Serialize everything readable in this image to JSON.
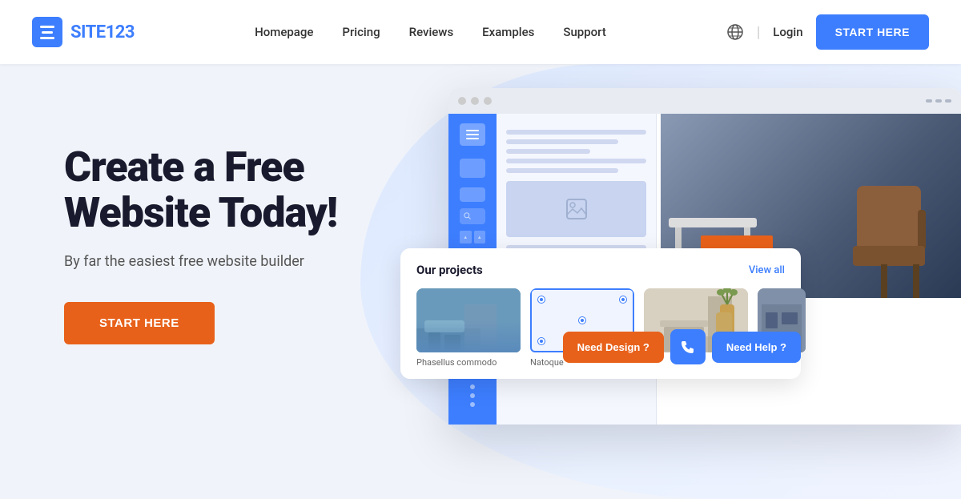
{
  "header": {
    "logo_text_site": "SITE",
    "logo_text_123": "123",
    "nav": {
      "homepage": "Homepage",
      "pricing": "Pricing",
      "reviews": "Reviews",
      "examples": "Examples",
      "support": "Support",
      "login": "Login",
      "start_here": "START HERE"
    }
  },
  "hero": {
    "title_line1": "Create a Free",
    "title_line2": "Website Today!",
    "subtitle": "By far the easiest free website builder",
    "cta_button": "START HERE"
  },
  "mockup": {
    "projects_title": "Our projects",
    "view_all": "View all",
    "project_captions": [
      "Phasellus commodo",
      "Natoque",
      "",
      ""
    ],
    "chat_design": "Need Design ?",
    "chat_help": "Need Help ?"
  },
  "colors": {
    "blue": "#3d7eff",
    "orange": "#e8611a",
    "dark": "#1a1a2e"
  }
}
